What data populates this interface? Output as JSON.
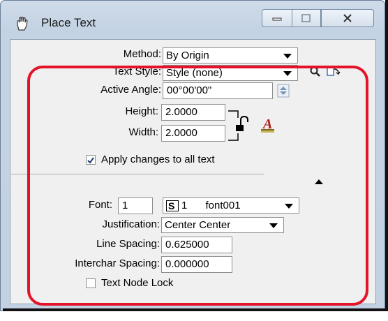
{
  "window": {
    "title": "Place Text",
    "app_icon": "hand-pointer-icon",
    "buttons": [
      "minimize-icon",
      "maximize-icon",
      "close-icon"
    ]
  },
  "method": {
    "label": "Method:",
    "value": "By Origin"
  },
  "text_style": {
    "label": "Text Style:",
    "value": "Style (none)",
    "icons": [
      "magnifier-icon",
      "style-manage-icon"
    ]
  },
  "active_angle": {
    "label": "Active Angle:",
    "value": "00°00'00\""
  },
  "height": {
    "label": "Height:",
    "value": "2.0000"
  },
  "width": {
    "label": "Width:",
    "value": "2.0000"
  },
  "apply_changes": {
    "label": "Apply changes to all text",
    "checked": true
  },
  "font": {
    "label": "Font:",
    "number": "1",
    "selected_number": "1",
    "selected_name": "font001"
  },
  "justification": {
    "label": "Justification:",
    "value": "Center Center"
  },
  "line_spacing": {
    "label": "Line Spacing:",
    "value": "0.625000"
  },
  "interchar_spacing": {
    "label": "Interchar Spacing:",
    "value": "0.000000"
  },
  "text_node_lock": {
    "label": "Text Node Lock",
    "checked": false
  },
  "colors": {
    "highlight": "#e3142a",
    "frame": "#c3d2e3",
    "client": "#f0f0f0"
  }
}
